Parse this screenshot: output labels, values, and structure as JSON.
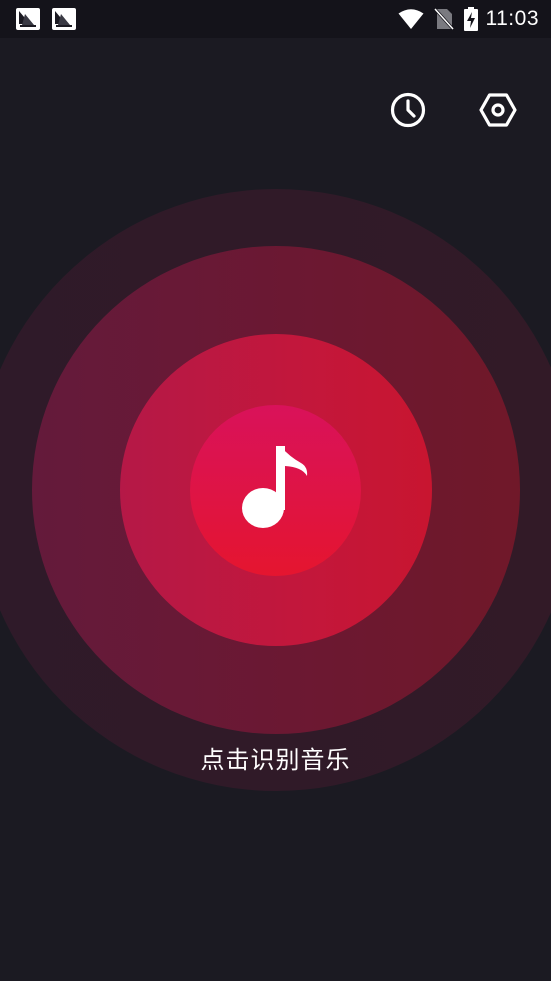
{
  "status_bar": {
    "time": "11:03",
    "notifications": [
      "notification-app-icon",
      "notification-app-icon"
    ],
    "icons": [
      "wifi-icon",
      "no-sim-icon",
      "battery-charging-icon"
    ]
  },
  "actions": {
    "history": {
      "icon": "history-clock-icon"
    },
    "settings": {
      "icon": "settings-hexagon-icon"
    }
  },
  "main": {
    "record_icon": "music-note-icon",
    "prompt": "点击识别音乐"
  },
  "colors": {
    "background": "#1b1a22",
    "status_bar": "#14131a",
    "ripple_outer": "#301a28",
    "ripple_mid": "#6a1833",
    "ripple_inner": "#c0173d",
    "button": "#e0143f",
    "text": "#ffffff"
  }
}
